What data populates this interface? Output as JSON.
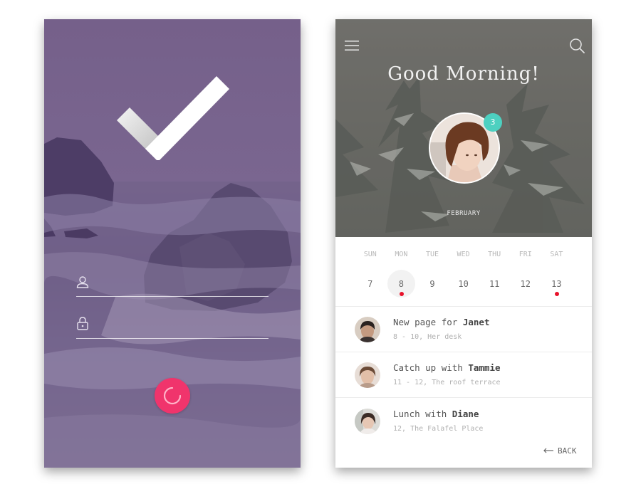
{
  "login": {
    "username_placeholder": "",
    "password_placeholder": "",
    "icons": [
      "checkmark-icon",
      "user-icon",
      "lock-icon",
      "spinner-icon"
    ]
  },
  "calendar": {
    "greeting": "Good Morning!",
    "notification_count": "3",
    "month": "FEBRUARY",
    "weekdays": [
      "SUN",
      "MON",
      "TUE",
      "WED",
      "THU",
      "FRI",
      "SAT"
    ],
    "dates": [
      "7",
      "8",
      "9",
      "10",
      "11",
      "12",
      "13"
    ],
    "selected_date": "8",
    "event_dot_dates": [
      "8",
      "13"
    ],
    "events": [
      {
        "title_prefix": "New page for ",
        "person": "Janet",
        "detail": "8 - 10, Her desk"
      },
      {
        "title_prefix": "Catch up with ",
        "person": "Tammie",
        "detail": "11 - 12, The roof terrace"
      },
      {
        "title_prefix": "Lunch with ",
        "person": "Diane",
        "detail": "12, The Falafel Place"
      }
    ],
    "back_label": "BACK",
    "icons": [
      "menu-icon",
      "search-icon",
      "back-arrow-icon"
    ],
    "colors": {
      "accent": "#f0346c",
      "badge": "#4dd0c0",
      "event_dot": "#e8122b"
    }
  }
}
